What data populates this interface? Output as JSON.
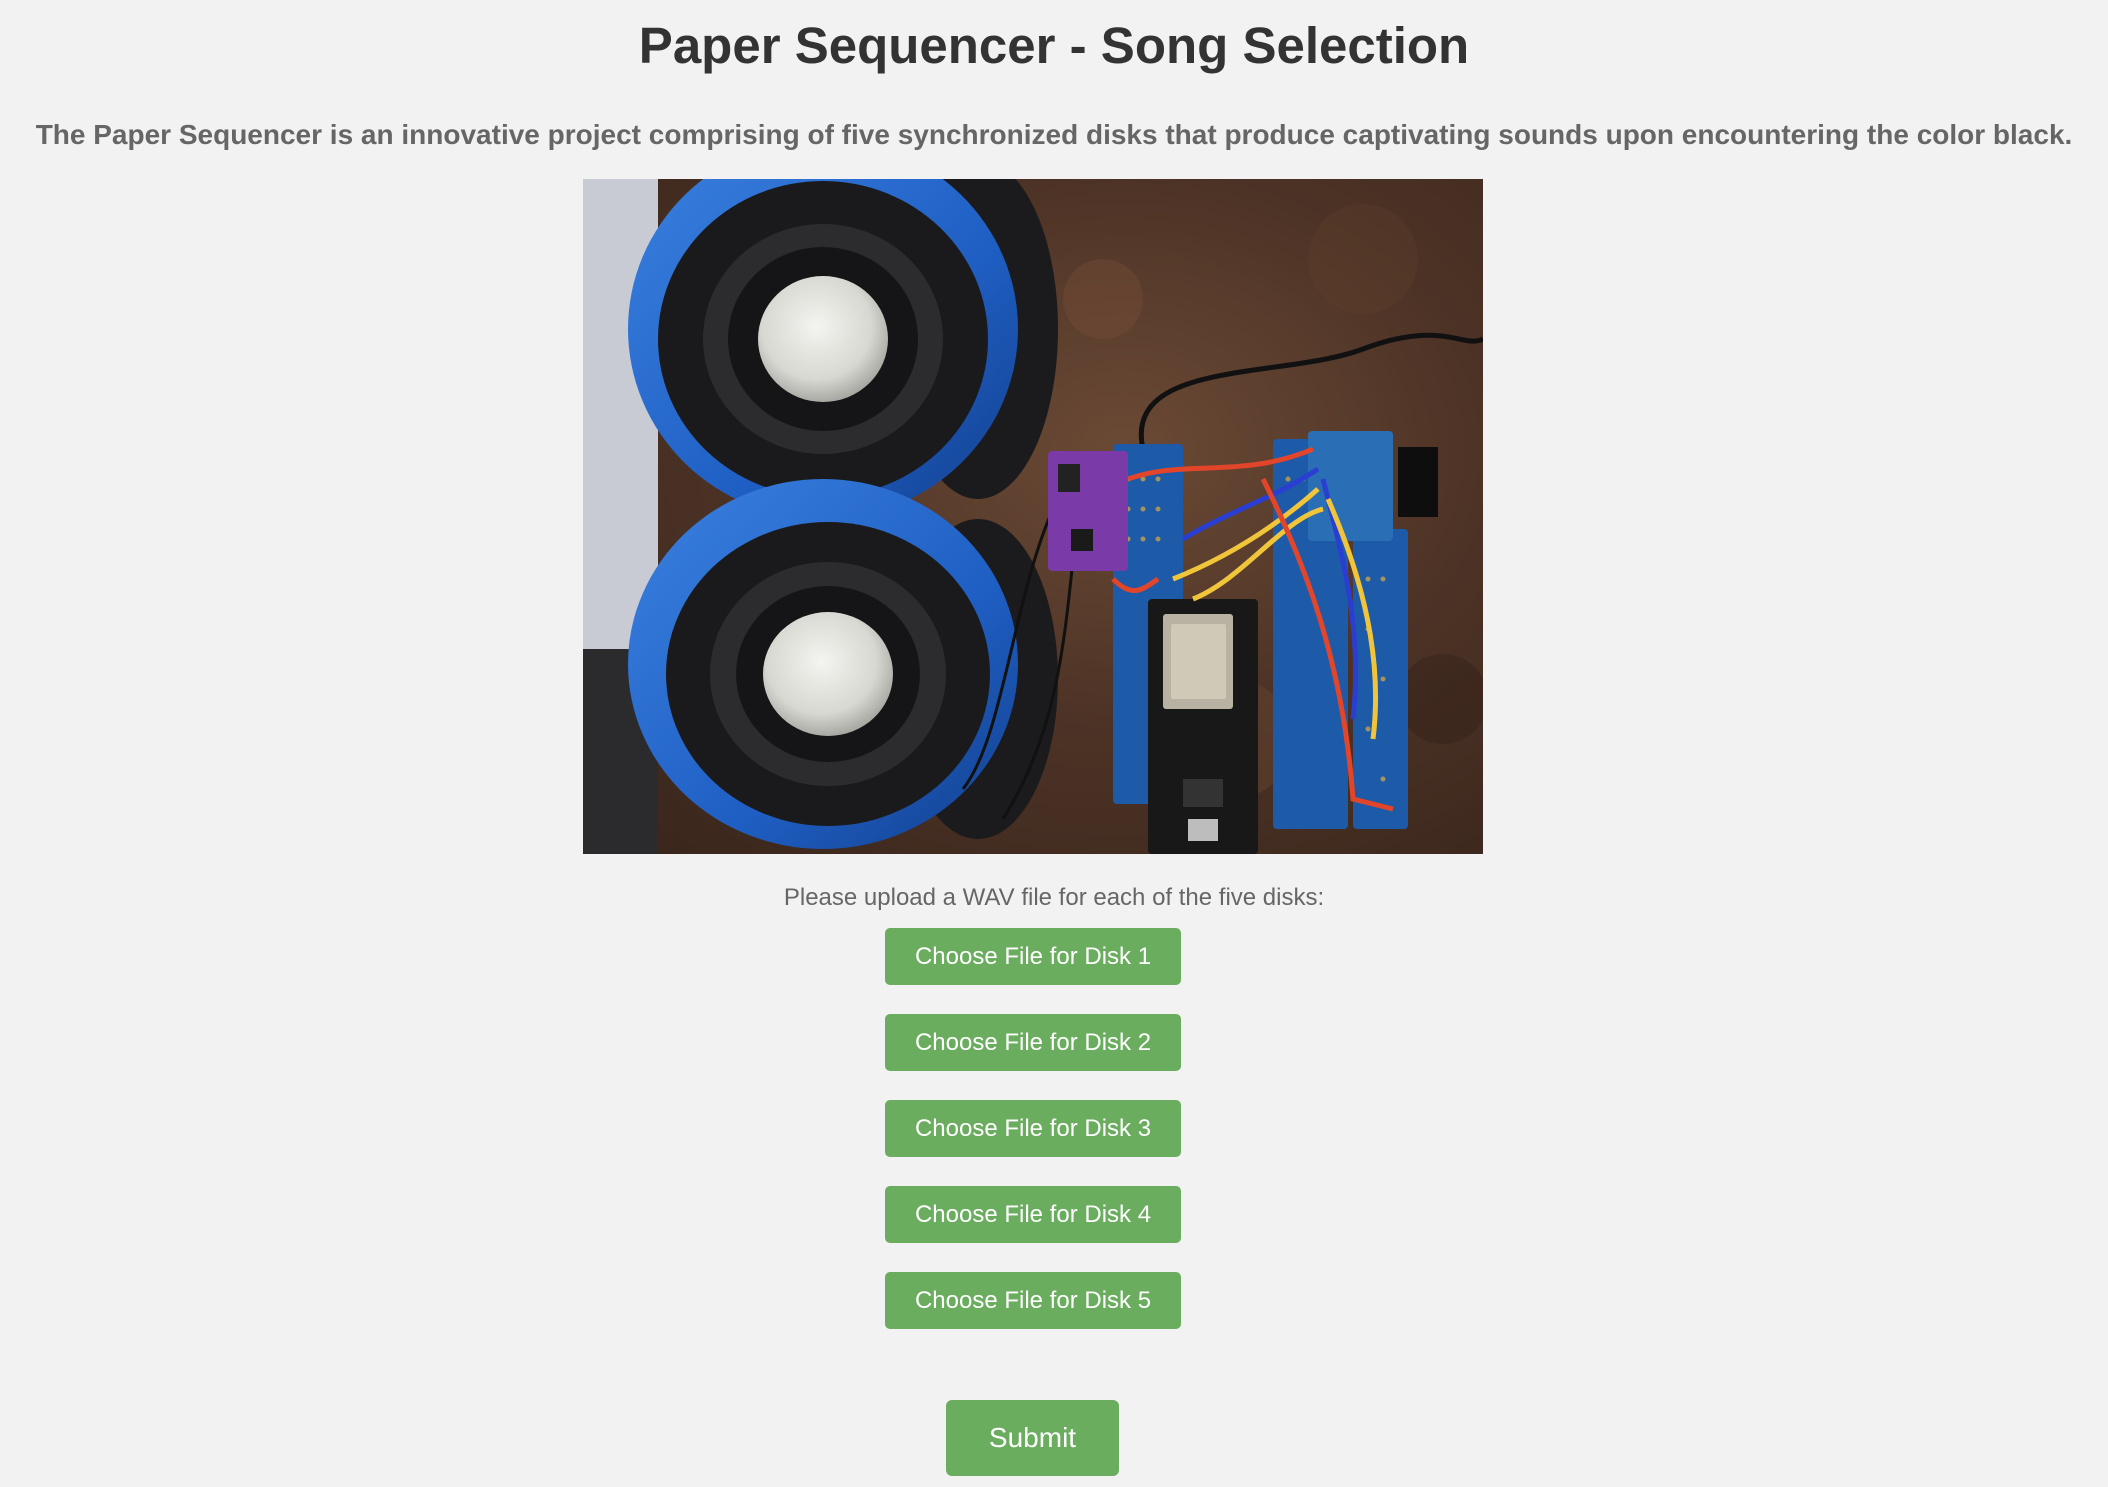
{
  "header": {
    "title": "Paper Sequencer - Song Selection",
    "description": "The Paper Sequencer is an innovative project comprising of five synchronized disks that produce captivating sounds upon encountering the color black."
  },
  "photo": {
    "subject": "speakers-and-circuit-board"
  },
  "upload": {
    "instructions": "Please upload a WAV file for each of the five disks:",
    "buttons": [
      "Choose File for Disk 1",
      "Choose File for Disk 2",
      "Choose File for Disk 3",
      "Choose File for Disk 4",
      "Choose File for Disk 5"
    ]
  },
  "submit_label": "Submit",
  "colors": {
    "background": "#f2f2f2",
    "button": "#6aad5e",
    "title": "#333333",
    "text": "#666666"
  }
}
